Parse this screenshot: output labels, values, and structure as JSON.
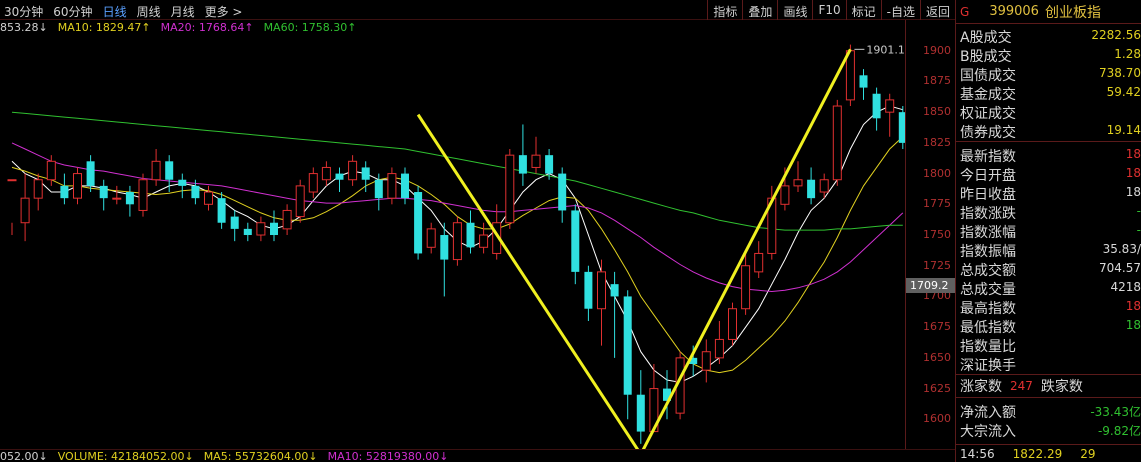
{
  "toolbar": {
    "periods": [
      {
        "label": "30分钟",
        "active": false
      },
      {
        "label": "60分钟",
        "active": false
      },
      {
        "label": "日线",
        "active": true
      },
      {
        "label": "周线",
        "active": false
      },
      {
        "label": "月线",
        "active": false
      },
      {
        "label": "更多 >",
        "active": false
      }
    ],
    "buttons": [
      "指标",
      "叠加",
      "画线",
      "F10",
      "标记",
      "-自选",
      "返回"
    ]
  },
  "ma_header": [
    {
      "text": "853.28↓",
      "color": "#d0d0d0"
    },
    {
      "text": "MA10: 1829.47↑",
      "color": "#e0d020"
    },
    {
      "text": "MA20: 1768.64↑",
      "color": "#d030d0"
    },
    {
      "text": "MA60: 1758.30↑",
      "color": "#30c030"
    }
  ],
  "volume_header": [
    {
      "text": "052.00↓",
      "color": "#d0d0d0"
    },
    {
      "text": "VOLUME: 42184052.00↓",
      "color": "#e0d020"
    },
    {
      "text": "MA5: 55732604.00↓",
      "color": "#e0d020"
    },
    {
      "text": "MA10: 52819380.00↓",
      "color": "#d030d0"
    }
  ],
  "price_axis": {
    "labels": [
      "1900",
      "1875",
      "1850",
      "1825",
      "1800",
      "1775",
      "1750",
      "1725",
      "1700",
      "1675",
      "1650",
      "1625",
      "1600"
    ],
    "current": "1709.2"
  },
  "annotations": {
    "high": "1901.15",
    "low": "1571.47"
  },
  "chart_data": {
    "type": "candlestick",
    "ylim": [
      1575,
      1912
    ],
    "high_marker": 1901.15,
    "low_marker": 1571.47,
    "current_price": 1709.2,
    "candles": [
      [
        1795,
        1795,
        1760,
        1750
      ],
      [
        1760,
        1780,
        1800,
        1745
      ],
      [
        1780,
        1795,
        1800,
        1770
      ],
      [
        1795,
        1810,
        1815,
        1790
      ],
      [
        1790,
        1780,
        1800,
        1775
      ],
      [
        1780,
        1800,
        1805,
        1775
      ],
      [
        1810,
        1790,
        1815,
        1785
      ],
      [
        1790,
        1780,
        1795,
        1770
      ],
      [
        1780,
        1780,
        1790,
        1775
      ],
      [
        1785,
        1775,
        1790,
        1765
      ],
      [
        1770,
        1795,
        1800,
        1765
      ],
      [
        1795,
        1810,
        1820,
        1790
      ],
      [
        1810,
        1795,
        1815,
        1785
      ],
      [
        1795,
        1790,
        1800,
        1780
      ],
      [
        1790,
        1780,
        1795,
        1775
      ],
      [
        1775,
        1785,
        1790,
        1770
      ],
      [
        1780,
        1760,
        1785,
        1755
      ],
      [
        1765,
        1755,
        1770,
        1745
      ],
      [
        1755,
        1750,
        1760,
        1745
      ],
      [
        1750,
        1760,
        1765,
        1745
      ],
      [
        1760,
        1750,
        1770,
        1745
      ],
      [
        1755,
        1770,
        1775,
        1750
      ],
      [
        1765,
        1790,
        1795,
        1760
      ],
      [
        1785,
        1800,
        1805,
        1780
      ],
      [
        1795,
        1805,
        1810,
        1790
      ],
      [
        1800,
        1795,
        1805,
        1785
      ],
      [
        1795,
        1810,
        1815,
        1790
      ],
      [
        1805,
        1795,
        1810,
        1785
      ],
      [
        1795,
        1780,
        1800,
        1770
      ],
      [
        1780,
        1800,
        1805,
        1775
      ],
      [
        1800,
        1780,
        1805,
        1775
      ],
      [
        1785,
        1735,
        1790,
        1730
      ],
      [
        1740,
        1755,
        1760,
        1735
      ],
      [
        1750,
        1730,
        1760,
        1700
      ],
      [
        1730,
        1760,
        1765,
        1725
      ],
      [
        1760,
        1740,
        1770,
        1735
      ],
      [
        1740,
        1750,
        1760,
        1735
      ],
      [
        1735,
        1760,
        1775,
        1730
      ],
      [
        1760,
        1815,
        1820,
        1755
      ],
      [
        1815,
        1800,
        1840,
        1790
      ],
      [
        1805,
        1815,
        1830,
        1800
      ],
      [
        1815,
        1800,
        1820,
        1795
      ],
      [
        1800,
        1770,
        1805,
        1760
      ],
      [
        1770,
        1720,
        1775,
        1710
      ],
      [
        1720,
        1690,
        1725,
        1680
      ],
      [
        1690,
        1720,
        1730,
        1660
      ],
      [
        1710,
        1700,
        1720,
        1650
      ],
      [
        1700,
        1620,
        1705,
        1600
      ],
      [
        1620,
        1590,
        1640,
        1580
      ],
      [
        1590,
        1625,
        1645,
        1590
      ],
      [
        1625,
        1615,
        1640,
        1600
      ],
      [
        1605,
        1650,
        1655,
        1600
      ],
      [
        1650,
        1645,
        1660,
        1635
      ],
      [
        1640,
        1655,
        1665,
        1630
      ],
      [
        1650,
        1665,
        1680,
        1645
      ],
      [
        1665,
        1690,
        1695,
        1660
      ],
      [
        1690,
        1725,
        1735,
        1685
      ],
      [
        1720,
        1735,
        1745,
        1715
      ],
      [
        1735,
        1780,
        1790,
        1730
      ],
      [
        1775,
        1790,
        1805,
        1770
      ],
      [
        1790,
        1795,
        1810,
        1785
      ],
      [
        1795,
        1780,
        1805,
        1775
      ],
      [
        1785,
        1795,
        1800,
        1780
      ],
      [
        1795,
        1855,
        1860,
        1790
      ],
      [
        1860,
        1900,
        1905,
        1855
      ],
      [
        1880,
        1870,
        1885,
        1860
      ],
      [
        1865,
        1845,
        1870,
        1835
      ],
      [
        1850,
        1860,
        1865,
        1830
      ],
      [
        1850,
        1825,
        1855,
        1820
      ]
    ],
    "ma_series": [
      {
        "color": "#ffffff",
        "values": [
          1810,
          1800,
          1795,
          1785,
          1785,
          1790,
          1790,
          1788,
          1785,
          1783,
          1780,
          1785,
          1790,
          1792,
          1790,
          1785,
          1778,
          1770,
          1765,
          1758,
          1755,
          1758,
          1765,
          1778,
          1790,
          1798,
          1802,
          1800,
          1795,
          1795,
          1790,
          1780,
          1770,
          1755,
          1745,
          1740,
          1745,
          1755,
          1770,
          1785,
          1795,
          1800,
          1795,
          1780,
          1750,
          1720,
          1700,
          1680,
          1655,
          1640,
          1632,
          1630,
          1635,
          1642,
          1650,
          1660,
          1675,
          1690,
          1710,
          1730,
          1752,
          1770,
          1780,
          1795,
          1820,
          1840,
          1850,
          1855,
          1852
        ]
      },
      {
        "color": "#e0d020",
        "values": [
          1805,
          1802,
          1798,
          1795,
          1790,
          1790,
          1788,
          1787,
          1786,
          1785,
          1784,
          1783,
          1784,
          1786,
          1787,
          1786,
          1783,
          1778,
          1773,
          1768,
          1764,
          1762,
          1762,
          1764,
          1769,
          1775,
          1782,
          1790,
          1795,
          1797,
          1795,
          1790,
          1783,
          1775,
          1765,
          1758,
          1755,
          1755,
          1759,
          1766,
          1772,
          1778,
          1781,
          1780,
          1770,
          1755,
          1738,
          1720,
          1700,
          1685,
          1670,
          1655,
          1645,
          1640,
          1638,
          1640,
          1648,
          1658,
          1668,
          1680,
          1695,
          1712,
          1728,
          1748,
          1770,
          1790,
          1805,
          1820,
          1830
        ]
      },
      {
        "color": "#d030d0",
        "values": [
          1825,
          1820,
          1815,
          1810,
          1807,
          1805,
          1803,
          1802,
          1800,
          1798,
          1796,
          1795,
          1794,
          1793,
          1792,
          1791,
          1790,
          1788,
          1786,
          1784,
          1782,
          1780,
          1778,
          1777,
          1776,
          1776,
          1777,
          1778,
          1779,
          1780,
          1780,
          1779,
          1778,
          1776,
          1774,
          1772,
          1770,
          1769,
          1769,
          1770,
          1771,
          1772,
          1773,
          1774,
          1772,
          1768,
          1762,
          1755,
          1748,
          1740,
          1733,
          1726,
          1720,
          1715,
          1711,
          1708,
          1706,
          1705,
          1704,
          1705,
          1707,
          1710,
          1714,
          1720,
          1728,
          1738,
          1748,
          1758,
          1768
        ]
      },
      {
        "color": "#30c030",
        "values": [
          1850,
          1849,
          1848,
          1847,
          1846,
          1845,
          1844,
          1843,
          1842,
          1841,
          1840,
          1839,
          1838,
          1837,
          1836,
          1835,
          1834,
          1833,
          1832,
          1831,
          1830,
          1829,
          1828,
          1827,
          1826,
          1825,
          1824,
          1823,
          1822,
          1821,
          1820,
          1818,
          1816,
          1814,
          1812,
          1810,
          1808,
          1806,
          1804,
          1802,
          1800,
          1798,
          1796,
          1794,
          1791,
          1788,
          1785,
          1782,
          1779,
          1776,
          1773,
          1770,
          1768,
          1765,
          1762,
          1760,
          1758,
          1756,
          1755,
          1754,
          1754,
          1754,
          1754,
          1755,
          1755,
          1756,
          1757,
          1758,
          1758
        ]
      }
    ],
    "trend_lines": [
      [
        [
          31,
          1848
        ],
        [
          48,
          1571.47
        ]
      ],
      [
        [
          48,
          1571.47
        ],
        [
          64,
          1901.15
        ]
      ]
    ]
  },
  "sidebar": {
    "marker": "G",
    "code": "399006",
    "name": "创业板指",
    "rows": [
      {
        "label": "A股成交",
        "value": "2282.56",
        "color": "#e0d020"
      },
      {
        "label": "B股成交",
        "value": "1.28",
        "color": "#e0d020"
      },
      {
        "label": "国债成交",
        "value": "738.70",
        "color": "#e0d020"
      },
      {
        "label": "基金成交",
        "value": "59.42",
        "color": "#e0d020"
      },
      {
        "label": "权证成交",
        "value": "",
        "color": "#e0d020"
      },
      {
        "label": "债券成交",
        "value": "19.14",
        "color": "#e0d020"
      }
    ],
    "rows2": [
      {
        "label": "最新指数",
        "value": "18",
        "color": "#e03030"
      },
      {
        "label": "今日开盘",
        "value": "18",
        "color": "#e03030"
      },
      {
        "label": "昨日收盘",
        "value": "18",
        "color": "#d8d8d8"
      },
      {
        "label": "指数涨跌",
        "value": "-",
        "color": "#30c030"
      },
      {
        "label": "指数涨幅",
        "value": "-",
        "color": "#30c030"
      },
      {
        "label": "指数振幅",
        "value": "35.83/",
        "color": "#d8d8d8"
      },
      {
        "label": "总成交额",
        "value": "704.57",
        "color": "#d8d8d8"
      },
      {
        "label": "总成交量",
        "value": "4218",
        "color": "#d8d8d8"
      },
      {
        "label": "最高指数",
        "value": "18",
        "color": "#e03030"
      },
      {
        "label": "最低指数",
        "value": "18",
        "color": "#30c030"
      },
      {
        "label": "指数量比",
        "value": "",
        "color": "#d8d8d8"
      },
      {
        "label": "深证换手",
        "value": "",
        "color": "#d8d8d8"
      }
    ],
    "updown": {
      "up_label": "涨家数",
      "up_value": "247",
      "down_label": "跌家数"
    },
    "flows": [
      {
        "label": "净流入额",
        "value": "-33.43亿",
        "color": "#30c030"
      },
      {
        "label": "大宗流入",
        "value": "-9.82亿",
        "color": "#30c030"
      }
    ],
    "bottom": {
      "time": "14:56",
      "price": "1822.29",
      "extra": "29"
    }
  }
}
